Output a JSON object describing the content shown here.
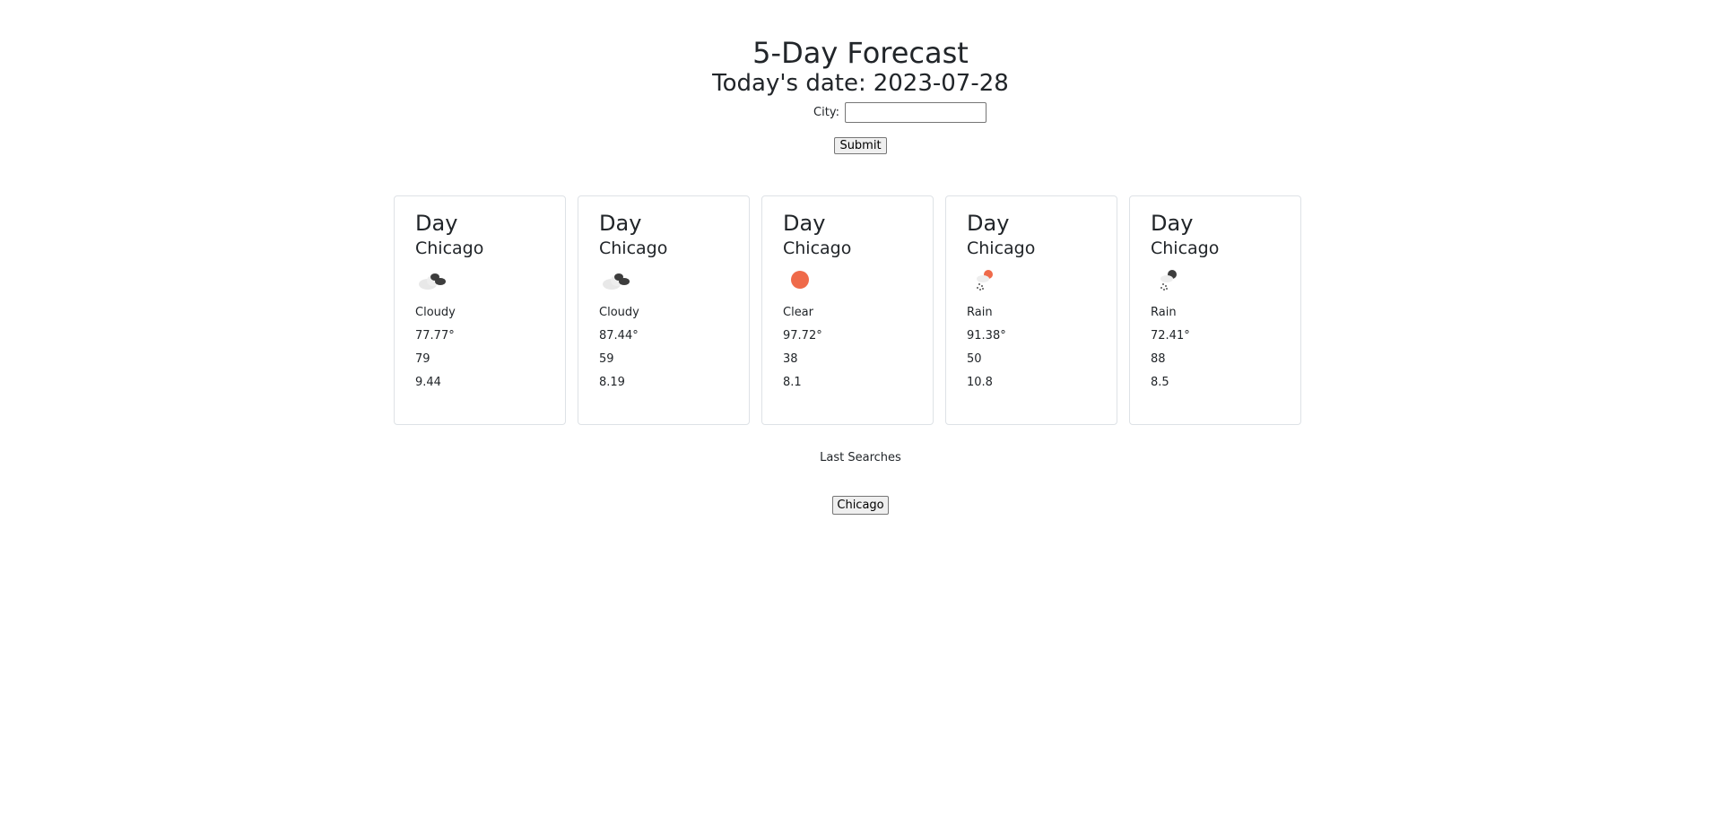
{
  "header": {
    "title": "5-Day Forecast",
    "date_label": "Today's date:",
    "date_value": "2023-07-28"
  },
  "form": {
    "city_label": "City:",
    "city_value": "",
    "submit_label": "Submit"
  },
  "cards": [
    {
      "day": "Day",
      "city": "Chicago",
      "icon": "cloudy-icon",
      "condition": "Cloudy",
      "temp": "77.77°",
      "humidity": "79",
      "wind": "9.44"
    },
    {
      "day": "Day",
      "city": "Chicago",
      "icon": "cloudy-icon",
      "condition": "Cloudy",
      "temp": "87.44°",
      "humidity": "59",
      "wind": "8.19"
    },
    {
      "day": "Day",
      "city": "Chicago",
      "icon": "sun-icon",
      "condition": "Clear",
      "temp": "97.72°",
      "humidity": "38",
      "wind": "8.1"
    },
    {
      "day": "Day",
      "city": "Chicago",
      "icon": "rain-sun-icon",
      "condition": "Rain",
      "temp": "91.38°",
      "humidity": "50",
      "wind": "10.8"
    },
    {
      "day": "Day",
      "city": "Chicago",
      "icon": "rain-icon",
      "condition": "Rain",
      "temp": "72.41°",
      "humidity": "88",
      "wind": "8.5"
    }
  ],
  "history": {
    "heading": "Last Searches",
    "items": [
      "Chicago"
    ]
  },
  "colors": {
    "sun": "#ef6a4a",
    "cloud_dark": "#3d3d3d",
    "cloud_light": "#e8e8e8",
    "card_border": "#dee2e6"
  }
}
